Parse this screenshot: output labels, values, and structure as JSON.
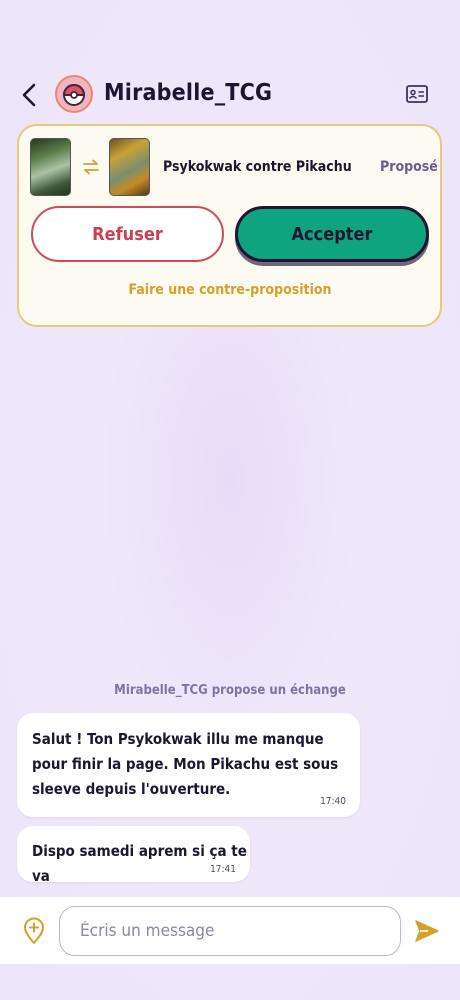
{
  "header": {
    "back_icon": "chevron-left-icon",
    "title": "Mirabelle_TCG",
    "avatar_icon": "pokeball-avatar-icon",
    "profile_icon": "contact-card-icon"
  },
  "trade": {
    "offered_card_icon": "card-thumbnail-psykokwak",
    "swap_icon": "swap-arrows-icon",
    "requested_card_icon": "card-thumbnail-pikachu",
    "label": "Psykokwak contre Pikachu",
    "status": "Proposé",
    "refuse_label": "Refuser",
    "accept_label": "Accepter",
    "counter_label": "Faire une contre-proposition"
  },
  "chat": {
    "system_message": "Mirabelle_TCG propose un échange",
    "messages": [
      {
        "text": "Salut ! Ton Psykokwak illu me manque pour finir la page. Mon Pikachu est sous sleeve depuis l'ouverture.",
        "time": "17:40"
      },
      {
        "text": "Dispo samedi aprem si ça te va",
        "time": "17:41"
      }
    ]
  },
  "composer": {
    "location_icon": "location-pin-add-icon",
    "placeholder": "Écris un message",
    "value": "",
    "send_icon": "send-icon"
  },
  "colors": {
    "accent_gold": "#d4a12a",
    "accept_green": "#10a37f",
    "refuse_red": "#cf4b5a",
    "status_purple": "#6b5b93"
  }
}
